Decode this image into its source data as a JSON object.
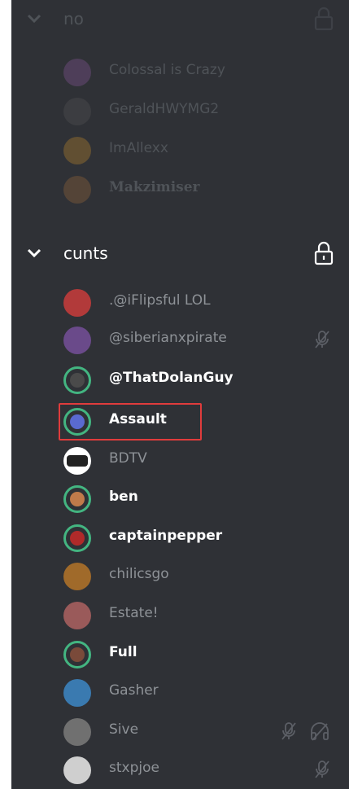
{
  "channels": [
    {
      "name": "no",
      "members": [
        {
          "name": "Colossal is Crazy",
          "avatar_color": "#8a5a9a"
        },
        {
          "name": "GeraldHWYMG2",
          "avatar_color": "#555555"
        },
        {
          "name": "ImAllexx",
          "avatar_color": "#c08a2a"
        },
        {
          "name": "Makzimiser",
          "avatar_color": "#9a6a3a"
        }
      ]
    },
    {
      "name": "cunts",
      "members": [
        {
          "name": ".@iFlipsful LOL",
          "avatar_color": "#b23a3a"
        },
        {
          "name": "@siberianxpirate",
          "avatar_color": "#6a4a8a"
        },
        {
          "name": "@ThatDolanGuy",
          "avatar_color": "#4a4a4a"
        },
        {
          "name": "Assault",
          "avatar_color": "#5a6ad0"
        },
        {
          "name": "BDTV",
          "avatar_color": "#222222"
        },
        {
          "name": "ben",
          "avatar_color": "#c07a4a"
        },
        {
          "name": "captainpepper",
          "avatar_color": "#b02a2a"
        },
        {
          "name": "chilicsgo",
          "avatar_color": "#a06a2a"
        },
        {
          "name": "Estate!",
          "avatar_color": "#9a5a5a"
        },
        {
          "name": "Full",
          "avatar_color": "#7a4a3a"
        },
        {
          "name": "Gasher",
          "avatar_color": "#3a7ab0"
        },
        {
          "name": "Sive",
          "avatar_color": "#707070"
        },
        {
          "name": "stxpjoe",
          "avatar_color": "#cfcfcf"
        }
      ]
    }
  ],
  "colors": {
    "background": "#2f3136",
    "speaking_ring": "#43b581",
    "highlight": "#e03c3c"
  },
  "icons": {
    "chevron": "chevron-down-icon",
    "lock": "lock-icon",
    "muted": "mic-muted-icon",
    "deafened": "headphones-muted-icon"
  }
}
